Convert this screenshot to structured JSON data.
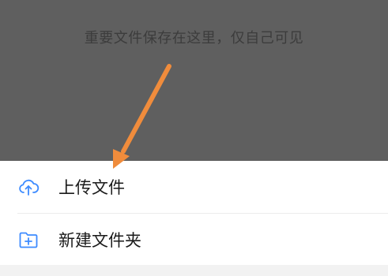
{
  "overlay": {
    "empty_hint": "重要文件保存在这里，仅自己可见"
  },
  "menu": {
    "items": [
      {
        "label": "上传文件",
        "icon": "cloud-upload-icon"
      },
      {
        "label": "新建文件夹",
        "icon": "new-folder-icon"
      }
    ]
  },
  "colors": {
    "accent": "#3d8bff",
    "overlay": "#5f5f5f",
    "annotation_arrow": "#f08c3c"
  }
}
